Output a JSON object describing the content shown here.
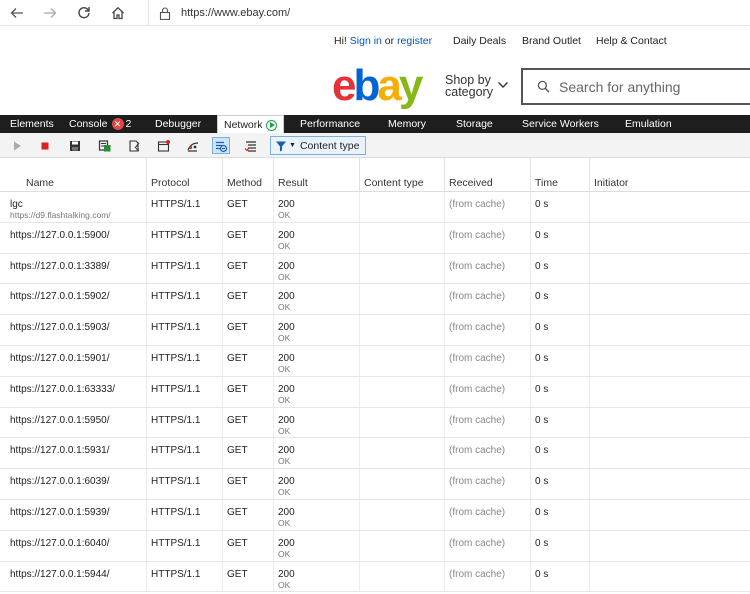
{
  "browser": {
    "url": "https://www.ebay.com/"
  },
  "ebay": {
    "greeting": "Hi!",
    "sign_in": "Sign in",
    "or": "or",
    "register": "register",
    "daily_deals": "Daily Deals",
    "brand_outlet": "Brand Outlet",
    "help_contact": "Help & Contact",
    "logo": {
      "e": "e",
      "b": "b",
      "a": "a",
      "y": "y"
    },
    "shop_by_line1": "Shop by",
    "shop_by_line2": "category",
    "search_placeholder": "Search for anything"
  },
  "devtools": {
    "tabs": {
      "elements": "Elements",
      "console": "Console",
      "console_errors": "2",
      "debugger": "Debugger",
      "network": "Network",
      "performance": "Performance",
      "memory": "Memory",
      "storage": "Storage",
      "service_workers": "Service Workers",
      "emulation": "Emulation"
    },
    "toolbar": {
      "filter_label": "Content type"
    },
    "columns": {
      "name": "Name",
      "protocol": "Protocol",
      "method": "Method",
      "result": "Result",
      "content_type": "Content type",
      "received": "Received",
      "time": "Time",
      "initiator": "Initiator"
    },
    "rows": [
      {
        "name": "lgc",
        "sub": "https://d9.flashtalking.com/",
        "protocol": "HTTPS/1.1",
        "method": "GET",
        "status": "200",
        "status_text": "OK",
        "content_type": "",
        "received": "(from cache)",
        "time": "0 s",
        "initiator": ""
      },
      {
        "name": "https://127.0.0.1:5900/",
        "sub": "",
        "protocol": "HTTPS/1.1",
        "method": "GET",
        "status": "200",
        "status_text": "OK",
        "content_type": "",
        "received": "(from cache)",
        "time": "0 s",
        "initiator": ""
      },
      {
        "name": "https://127.0.0.1:3389/",
        "sub": "",
        "protocol": "HTTPS/1.1",
        "method": "GET",
        "status": "200",
        "status_text": "OK",
        "content_type": "",
        "received": "(from cache)",
        "time": "0 s",
        "initiator": ""
      },
      {
        "name": "https://127.0.0.1:5902/",
        "sub": "",
        "protocol": "HTTPS/1.1",
        "method": "GET",
        "status": "200",
        "status_text": "OK",
        "content_type": "",
        "received": "(from cache)",
        "time": "0 s",
        "initiator": ""
      },
      {
        "name": "https://127.0.0.1:5903/",
        "sub": "",
        "protocol": "HTTPS/1.1",
        "method": "GET",
        "status": "200",
        "status_text": "OK",
        "content_type": "",
        "received": "(from cache)",
        "time": "0 s",
        "initiator": ""
      },
      {
        "name": "https://127.0.0.1:5901/",
        "sub": "",
        "protocol": "HTTPS/1.1",
        "method": "GET",
        "status": "200",
        "status_text": "OK",
        "content_type": "",
        "received": "(from cache)",
        "time": "0 s",
        "initiator": ""
      },
      {
        "name": "https://127.0.0.1:63333/",
        "sub": "",
        "protocol": "HTTPS/1.1",
        "method": "GET",
        "status": "200",
        "status_text": "OK",
        "content_type": "",
        "received": "(from cache)",
        "time": "0 s",
        "initiator": ""
      },
      {
        "name": "https://127.0.0.1:5950/",
        "sub": "",
        "protocol": "HTTPS/1.1",
        "method": "GET",
        "status": "200",
        "status_text": "OK",
        "content_type": "",
        "received": "(from cache)",
        "time": "0 s",
        "initiator": ""
      },
      {
        "name": "https://127.0.0.1:5931/",
        "sub": "",
        "protocol": "HTTPS/1.1",
        "method": "GET",
        "status": "200",
        "status_text": "OK",
        "content_type": "",
        "received": "(from cache)",
        "time": "0 s",
        "initiator": ""
      },
      {
        "name": "https://127.0.0.1:6039/",
        "sub": "",
        "protocol": "HTTPS/1.1",
        "method": "GET",
        "status": "200",
        "status_text": "OK",
        "content_type": "",
        "received": "(from cache)",
        "time": "0 s",
        "initiator": ""
      },
      {
        "name": "https://127.0.0.1:5939/",
        "sub": "",
        "protocol": "HTTPS/1.1",
        "method": "GET",
        "status": "200",
        "status_text": "OK",
        "content_type": "",
        "received": "(from cache)",
        "time": "0 s",
        "initiator": ""
      },
      {
        "name": "https://127.0.0.1:6040/",
        "sub": "",
        "protocol": "HTTPS/1.1",
        "method": "GET",
        "status": "200",
        "status_text": "OK",
        "content_type": "",
        "received": "(from cache)",
        "time": "0 s",
        "initiator": ""
      },
      {
        "name": "https://127.0.0.1:5944/",
        "sub": "",
        "protocol": "HTTPS/1.1",
        "method": "GET",
        "status": "200",
        "status_text": "OK",
        "content_type": "",
        "received": "(from cache)",
        "time": "0 s",
        "initiator": ""
      }
    ]
  },
  "colors": {
    "ebay_red": "#e53238",
    "ebay_blue": "#0064d2",
    "ebay_yellow": "#f5af02",
    "ebay_green": "#86b817",
    "link_blue": "#0654ba",
    "devtools_tabbar": "#1e1e1e",
    "error_badge": "#e04848",
    "network_indicator": "#1aa04b",
    "record_stop": "#e02020"
  },
  "icons": [
    "back-arrow-icon",
    "forward-arrow-icon",
    "refresh-icon",
    "home-icon",
    "lock-icon",
    "chevron-down-icon",
    "search-icon",
    "play-icon",
    "stop-record-icon",
    "save-icon",
    "import-icon",
    "clear-cache-icon",
    "clear-cookies-icon",
    "always-refresh-icon",
    "clear-session-icon",
    "clear-entries-icon",
    "filter-icon"
  ]
}
